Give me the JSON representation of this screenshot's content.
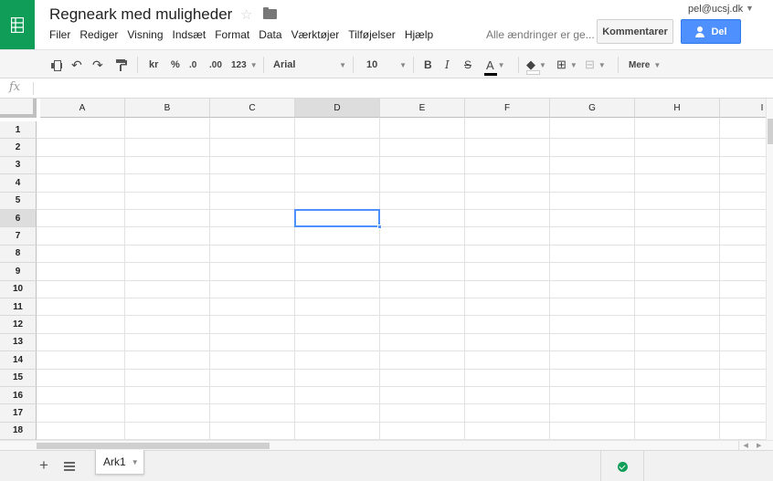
{
  "document": {
    "title": "Regneark med muligheder",
    "user_email": "pel@ucsj.dk",
    "save_status": "Alle ændringer er ge..."
  },
  "menu": [
    "Filer",
    "Rediger",
    "Visning",
    "Indsæt",
    "Format",
    "Data",
    "Værktøjer",
    "Tilføjelser",
    "Hjælp"
  ],
  "buttons": {
    "comments": "Kommentarer",
    "share": "Del"
  },
  "toolbar": {
    "currency": "kr",
    "percent": "%",
    "decrease_decimals": ".0",
    "increase_decimals": ".00",
    "more_formats": "123",
    "font": "Arial",
    "font_size": "10",
    "bold": "B",
    "italic": "I",
    "strikethrough": "S",
    "text_color": "A",
    "more": "Mere"
  },
  "formula": {
    "icon": "fx",
    "value": ""
  },
  "grid": {
    "columns": [
      "A",
      "B",
      "C",
      "D",
      "E",
      "F",
      "G",
      "H",
      "I"
    ],
    "rows": [
      "1",
      "2",
      "3",
      "4",
      "5",
      "6",
      "7",
      "8",
      "9",
      "10",
      "11",
      "12",
      "13",
      "14",
      "15",
      "16",
      "17",
      "18"
    ],
    "active_column": "D",
    "active_row": "6"
  },
  "sheets": {
    "tabs": [
      "Ark1"
    ],
    "add_label": "+"
  },
  "colors": {
    "brand_green": "#0f9d58",
    "share_blue": "#4d90fe",
    "selection_blue": "#4d90fe"
  },
  "icons": {
    "logo": "sheets-logo-icon",
    "star": "star-icon",
    "folder": "folder-icon",
    "print": "print-icon",
    "undo": "undo-icon",
    "redo": "redo-icon",
    "paint_format": "paint-format-icon",
    "fill_color": "fill-color-icon",
    "borders": "borders-icon",
    "merge": "merge-cells-icon",
    "status": "saved-check-icon"
  }
}
